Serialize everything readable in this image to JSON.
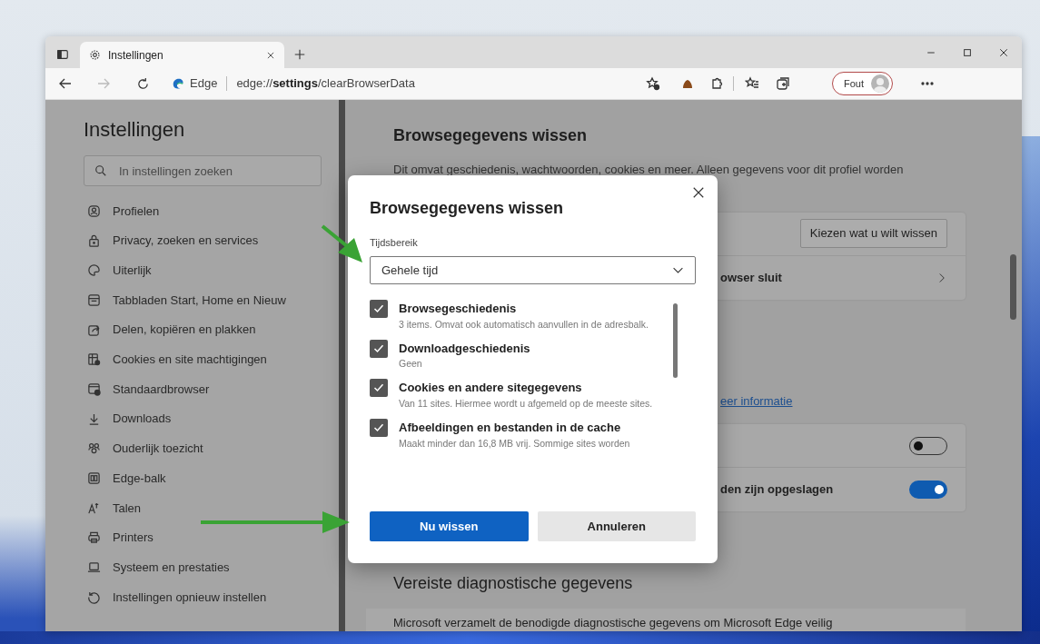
{
  "window": {
    "tabs": [
      {
        "title": "Instellingen",
        "selected": true
      }
    ],
    "nav": {
      "forward_disabled": true
    },
    "address": {
      "site_label": "Edge",
      "url_prefix": "edge://",
      "url_bold": "settings",
      "url_rest": "/clearBrowserData"
    },
    "profile_label": "Fout"
  },
  "sidebar": {
    "title": "Instellingen",
    "search": {
      "placeholder": "In instellingen zoeken"
    },
    "items": [
      {
        "label": "Profielen"
      },
      {
        "label": "Privacy, zoeken en services"
      },
      {
        "label": "Uiterlijk"
      },
      {
        "label": "Tabbladen Start, Home en Nieuw"
      },
      {
        "label": "Delen, kopiëren en plakken"
      },
      {
        "label": "Cookies en site machtigingen"
      },
      {
        "label": "Standaardbrowser"
      },
      {
        "label": "Downloads"
      },
      {
        "label": "Ouderlijk toezicht"
      },
      {
        "label": "Edge-balk"
      },
      {
        "label": "Talen"
      },
      {
        "label": "Printers"
      },
      {
        "label": "Systeem en prestaties"
      },
      {
        "label": "Instellingen opnieuw instellen"
      }
    ]
  },
  "main": {
    "heading": "Browsegegevens wissen",
    "description": "Dit omvat geschiedenis, wachtwoorden, cookies en meer. Alleen gegevens voor dit profiel worden",
    "choose_button": "Kiezen wat u wilt wissen",
    "row_fragment": "owser sluit",
    "link_fragment": "eer informatie",
    "toggles": [
      {
        "on": false
      },
      {
        "label": "den zijn opgeslagen",
        "on": true
      }
    ],
    "section_heading": "Vereiste diagnostische gegevens",
    "section_text": "Microsoft verzamelt de benodigde diagnostische gegevens om Microsoft Edge veilig"
  },
  "dialog": {
    "title": "Browsegegevens wissen",
    "range_label": "Tijdsbereik",
    "range_value": "Gehele tijd",
    "options": [
      {
        "label": "Browsegeschiedenis",
        "description": "3 items. Omvat ook automatisch aanvullen in de adresbalk.",
        "checked": true
      },
      {
        "label": "Downloadgeschiedenis",
        "description": "Geen",
        "checked": true
      },
      {
        "label": "Cookies en andere sitegegevens",
        "description": "Van 11 sites. Hiermee wordt u afgemeld op de meeste sites.",
        "checked": true
      },
      {
        "label": "Afbeeldingen en bestanden in de cache",
        "description": "Maakt minder dan 16,8 MB vrij. Sommige sites worden",
        "checked": true
      }
    ],
    "primary_button": "Nu wissen",
    "secondary_button": "Annuleren"
  }
}
